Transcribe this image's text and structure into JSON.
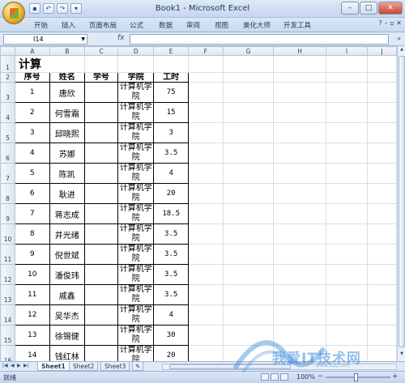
{
  "window": {
    "title": "Book1 - Microsoft Excel",
    "controls": {
      "minimize": "–",
      "maximize": "□",
      "close": "✕"
    }
  },
  "ribbon": {
    "tabs": [
      "开始",
      "插入",
      "页面布局",
      "公式",
      "数据",
      "审阅",
      "视图",
      "美化大师",
      "开发工具"
    ],
    "help_label": "?",
    "restore_label": "– ▫ ✕"
  },
  "formula_bar": {
    "name_box": "I14",
    "fx_label": "fx",
    "formula": "",
    "expand_glyph": "»"
  },
  "sheet": {
    "column_headers": [
      "A",
      "B",
      "C",
      "D",
      "E",
      "F",
      "G",
      "H",
      "I",
      "J"
    ],
    "row_numbers": [
      "1",
      "2",
      "3",
      "4",
      "5",
      "6",
      "7",
      "8",
      "9",
      "10",
      "11",
      "12",
      "13",
      "14",
      "15",
      "16"
    ],
    "title": "计算",
    "headers": [
      "序号",
      "姓名",
      "学号",
      "学院",
      "工时"
    ],
    "rows": [
      {
        "no": "1",
        "name": "唐欣",
        "id": "",
        "college": "计算机学院",
        "hours": "75"
      },
      {
        "no": "2",
        "name": "何雪霜",
        "id": "",
        "college": "计算机学院",
        "hours": "15"
      },
      {
        "no": "3",
        "name": "邱晓熙",
        "id": "",
        "college": "计算机学院",
        "hours": "3"
      },
      {
        "no": "4",
        "name": "苏娜",
        "id": "",
        "college": "计算机学院",
        "hours": "3.5"
      },
      {
        "no": "5",
        "name": "陈凯",
        "id": "",
        "college": "计算机学院",
        "hours": "4"
      },
      {
        "no": "6",
        "name": "耿进",
        "id": "",
        "college": "计算机学院",
        "hours": "20"
      },
      {
        "no": "7",
        "name": "蒋志成",
        "id": "",
        "college": "计算机学院",
        "hours": "18.5"
      },
      {
        "no": "8",
        "name": "井光绪",
        "id": "",
        "college": "计算机学院",
        "hours": "3.5"
      },
      {
        "no": "9",
        "name": "倪世斌",
        "id": "",
        "college": "计算机学院",
        "hours": "3.5"
      },
      {
        "no": "10",
        "name": "潘俊玮",
        "id": "",
        "college": "计算机学院",
        "hours": "3.5"
      },
      {
        "no": "11",
        "name": "戚鑫",
        "id": "",
        "college": "计算机学院",
        "hours": "3.5"
      },
      {
        "no": "12",
        "name": "吴华杰",
        "id": "",
        "college": "计算机学院",
        "hours": "4"
      },
      {
        "no": "13",
        "name": "徐锡健",
        "id": "",
        "college": "计算机学院",
        "hours": "30"
      },
      {
        "no": "14",
        "name": "钱红林",
        "id": "",
        "college": "计算机学院",
        "hours": "20"
      }
    ]
  },
  "sheet_tabs": [
    "Sheet1",
    "Sheet2",
    "Sheet3"
  ],
  "status": {
    "ready": "就绪",
    "zoom": "100%",
    "zoom_out": "−",
    "zoom_in": "+"
  },
  "watermark": {
    "text": "我爱IT技术网",
    "sub": "www.52ij.com"
  },
  "colors": {
    "ribbon_bg": "#dbe6f5",
    "grid_line": "#d8dee6",
    "watermark": "#3c8cdc"
  }
}
